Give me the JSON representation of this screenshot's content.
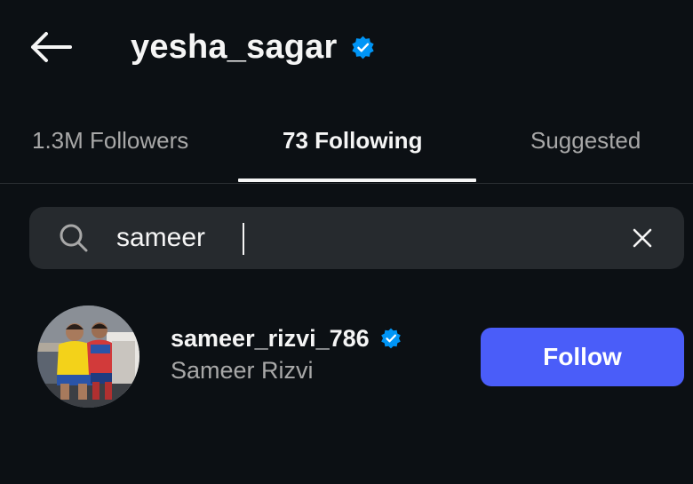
{
  "header": {
    "title": "yesha_sagar",
    "back_icon": "arrow-left-icon",
    "verified_icon": "verified-badge-icon"
  },
  "tabs": [
    {
      "label": "1.3M Followers",
      "active": false
    },
    {
      "label": "73 Following",
      "active": true
    },
    {
      "label": "Suggested",
      "active": false
    }
  ],
  "search": {
    "value": "sameer",
    "icon": "search-icon",
    "clear_icon": "close-icon"
  },
  "results": [
    {
      "username": "sameer_rizvi_786",
      "full_name": "Sameer Rizvi",
      "verified": true,
      "button_label": "Follow"
    }
  ],
  "colors": {
    "background": "#0c1014",
    "primary_text": "#f5f5f5",
    "secondary_text": "#a8a8a8",
    "search_bg": "#262a2e",
    "follow_button": "#4a5df9",
    "verified_badge": "#0095f6"
  }
}
